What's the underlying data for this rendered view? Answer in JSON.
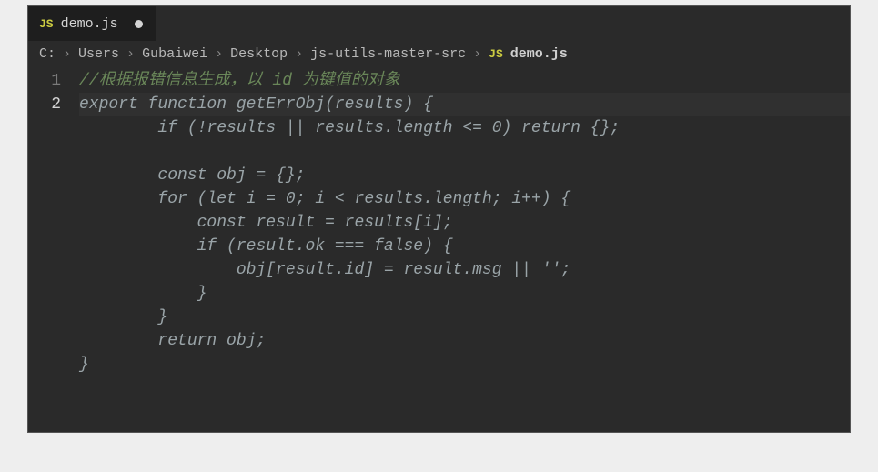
{
  "tab": {
    "icon_label": "JS",
    "filename": "demo.js",
    "modified": true
  },
  "breadcrumb": {
    "segments": [
      "C:",
      "Users",
      "Gubaiwei",
      "Desktop",
      "js-utils-master-src"
    ],
    "file_icon_label": "JS",
    "file": "demo.js",
    "separator": "›"
  },
  "gutter": {
    "numbers": [
      "1",
      "2"
    ]
  },
  "code": {
    "lines": [
      {
        "indent": 0,
        "tokens": [
          {
            "cls": "tok-comment",
            "t": "//根据报错信息生成，以 id 为键值的对象"
          }
        ]
      },
      {
        "indent": 0,
        "active": true,
        "tokens": [
          {
            "cls": "tok-kw",
            "t": "export "
          },
          {
            "cls": "tok-kw",
            "t": "function "
          },
          {
            "cls": "tok-func",
            "t": "getErrObj"
          },
          {
            "cls": "tok-punc",
            "t": "("
          },
          {
            "cls": "tok-id",
            "t": "results"
          },
          {
            "cls": "tok-punc",
            "t": ") {"
          }
        ]
      },
      {
        "indent": 2,
        "tokens": [
          {
            "cls": "tok-kw",
            "t": "if "
          },
          {
            "cls": "tok-punc",
            "t": "(!"
          },
          {
            "cls": "tok-id",
            "t": "results "
          },
          {
            "cls": "tok-punc",
            "t": "|| "
          },
          {
            "cls": "tok-id",
            "t": "results.length "
          },
          {
            "cls": "tok-punc",
            "t": "<= "
          },
          {
            "cls": "tok-id",
            "t": "0"
          },
          {
            "cls": "tok-punc",
            "t": ") "
          },
          {
            "cls": "tok-kw",
            "t": "return "
          },
          {
            "cls": "tok-punc",
            "t": "{};"
          }
        ]
      },
      {
        "indent": 0,
        "tokens": []
      },
      {
        "indent": 2,
        "tokens": [
          {
            "cls": "tok-kw",
            "t": "const "
          },
          {
            "cls": "tok-id",
            "t": "obj "
          },
          {
            "cls": "tok-punc",
            "t": "= {};"
          }
        ]
      },
      {
        "indent": 2,
        "tokens": [
          {
            "cls": "tok-kw",
            "t": "for "
          },
          {
            "cls": "tok-punc",
            "t": "("
          },
          {
            "cls": "tok-kw",
            "t": "let "
          },
          {
            "cls": "tok-id",
            "t": "i "
          },
          {
            "cls": "tok-punc",
            "t": "= "
          },
          {
            "cls": "tok-id",
            "t": "0"
          },
          {
            "cls": "tok-punc",
            "t": "; "
          },
          {
            "cls": "tok-id",
            "t": "i "
          },
          {
            "cls": "tok-punc",
            "t": "< "
          },
          {
            "cls": "tok-id",
            "t": "results.length"
          },
          {
            "cls": "tok-punc",
            "t": "; "
          },
          {
            "cls": "tok-id",
            "t": "i++"
          },
          {
            "cls": "tok-punc",
            "t": ") {"
          }
        ]
      },
      {
        "indent": 3,
        "tokens": [
          {
            "cls": "tok-kw",
            "t": "const "
          },
          {
            "cls": "tok-id",
            "t": "result "
          },
          {
            "cls": "tok-punc",
            "t": "= "
          },
          {
            "cls": "tok-id",
            "t": "results"
          },
          {
            "cls": "tok-punc",
            "t": "["
          },
          {
            "cls": "tok-id",
            "t": "i"
          },
          {
            "cls": "tok-punc",
            "t": "];"
          }
        ]
      },
      {
        "indent": 3,
        "tokens": [
          {
            "cls": "tok-kw",
            "t": "if "
          },
          {
            "cls": "tok-punc",
            "t": "("
          },
          {
            "cls": "tok-id",
            "t": "result.ok "
          },
          {
            "cls": "tok-punc",
            "t": "=== "
          },
          {
            "cls": "tok-kw",
            "t": "false"
          },
          {
            "cls": "tok-punc",
            "t": ") {"
          }
        ]
      },
      {
        "indent": 4,
        "tokens": [
          {
            "cls": "tok-id",
            "t": "obj"
          },
          {
            "cls": "tok-punc",
            "t": "["
          },
          {
            "cls": "tok-id",
            "t": "result.id"
          },
          {
            "cls": "tok-punc",
            "t": "] = "
          },
          {
            "cls": "tok-id",
            "t": "result.msg "
          },
          {
            "cls": "tok-punc",
            "t": "|| "
          },
          {
            "cls": "tok-str",
            "t": "''"
          },
          {
            "cls": "tok-punc",
            "t": ";"
          }
        ]
      },
      {
        "indent": 3,
        "tokens": [
          {
            "cls": "tok-punc",
            "t": "}"
          }
        ]
      },
      {
        "indent": 2,
        "tokens": [
          {
            "cls": "tok-punc",
            "t": "}"
          }
        ]
      },
      {
        "indent": 2,
        "tokens": [
          {
            "cls": "tok-kw",
            "t": "return "
          },
          {
            "cls": "tok-id",
            "t": "obj"
          },
          {
            "cls": "tok-punc",
            "t": ";"
          }
        ]
      },
      {
        "indent": 0,
        "tokens": [
          {
            "cls": "tok-punc",
            "t": "}"
          }
        ]
      }
    ]
  }
}
